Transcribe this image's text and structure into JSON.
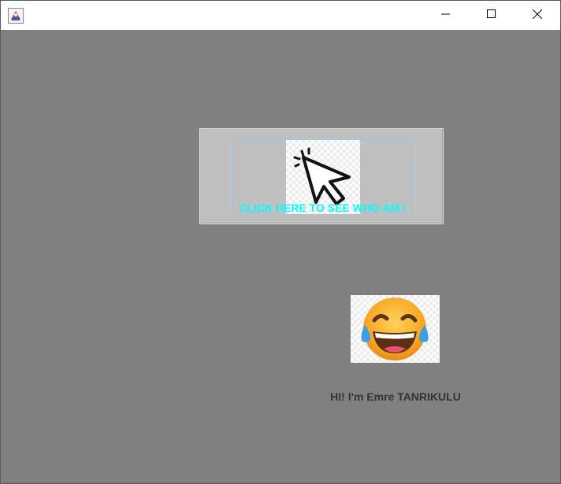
{
  "window": {
    "app_icon": "java-app-icon",
    "controls": {
      "minimize_icon": "minimize-icon",
      "maximize_icon": "maximize-icon",
      "close_icon": "close-icon"
    }
  },
  "main_button": {
    "label": "CLICK HERE TO SEE WHO AM I",
    "icon": "mouse-cursor-click-icon",
    "label_color": "#00ffff"
  },
  "reveal": {
    "emoji_icon": "face-with-tears-of-joy-icon",
    "greeting": "HI! I'm Emre TANRIKULU"
  },
  "colors": {
    "background": "#808080",
    "button_face": "#c0c0c0",
    "greeting_text": "#333333"
  }
}
